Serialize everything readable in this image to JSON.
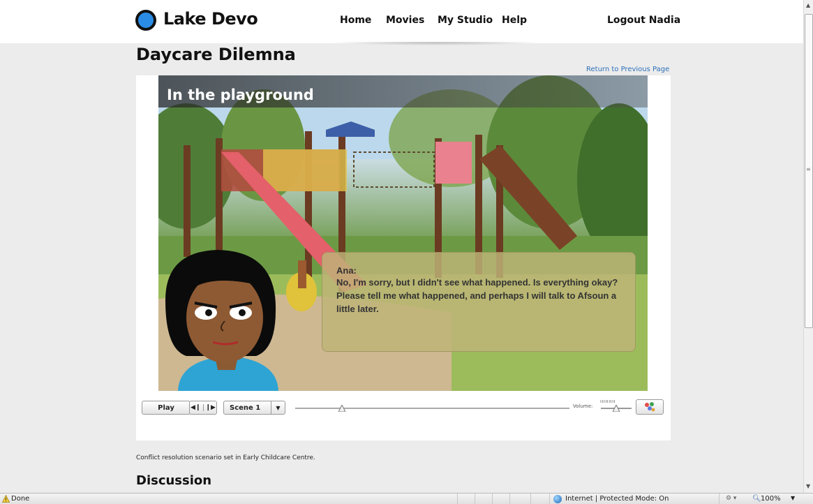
{
  "header": {
    "logo_text": "Lake Devo",
    "nav": [
      "Home",
      "Movies",
      "My Studio",
      "Help"
    ],
    "logout_label": "Logout Nadia"
  },
  "page": {
    "title": "Daycare Dilemna",
    "return_link": "Return to Previous Page",
    "description": "Conflict resolution scenario set in Early Childcare Centre.",
    "discussion_heading": "Discussion"
  },
  "player": {
    "scene_title": "In the playground",
    "speaker": "Ana:",
    "dialogue": "No, I'm sorry, but I didn't see what happened.  Is everything okay? Please tell me what happened, and perhaps I will talk to Afsoun a little later.",
    "play_label": "Play",
    "scene_select_value": "Scene 1",
    "volume_label": "Volume:",
    "progress_fraction": 0.17,
    "volume_fraction": 0.5
  },
  "statusbar": {
    "status": "Done",
    "zone": "Internet | Protected Mode: On",
    "zoom": "100%"
  },
  "colors": {
    "accent_link": "#2d6fb8",
    "logo_blue": "#2b8ce6",
    "speech_bubble": "#beb478"
  }
}
